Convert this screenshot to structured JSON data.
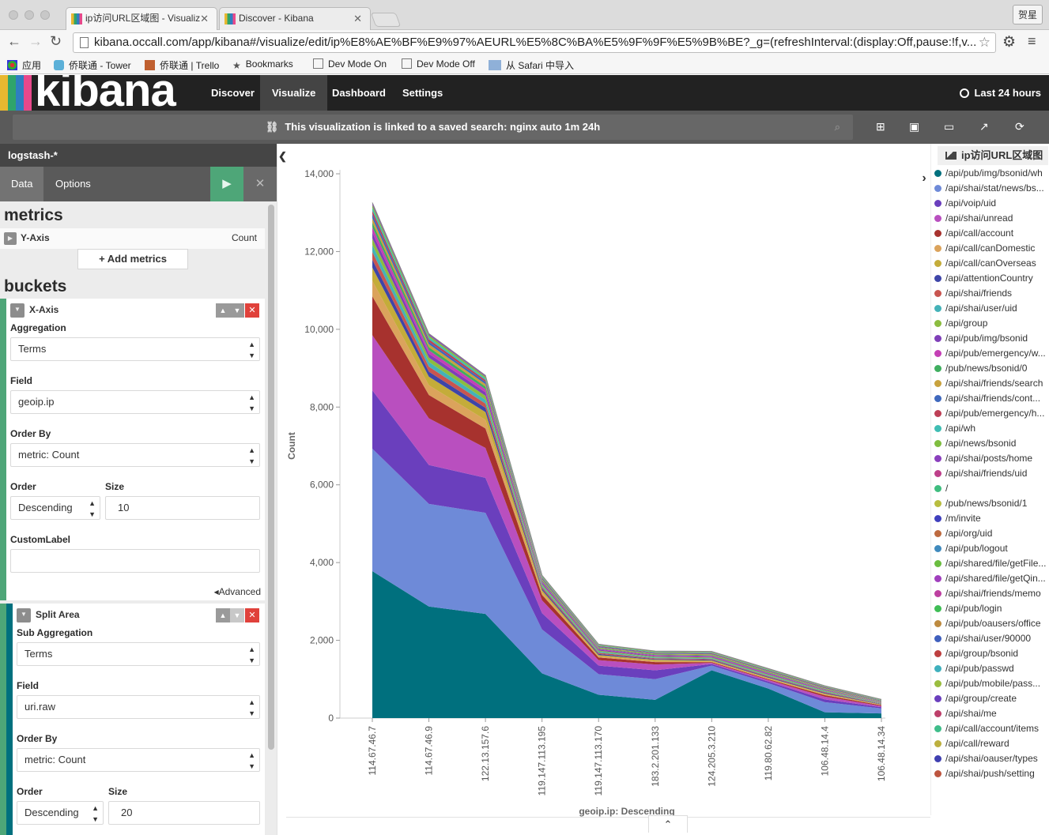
{
  "browser": {
    "tabs": [
      {
        "title": "ip访问URL区域图 - Visualiz",
        "active": true
      },
      {
        "title": "Discover - Kibana",
        "active": false
      }
    ],
    "profile": "贺星",
    "url": "kibana.occall.com/app/kibana#/visualize/edit/ip%E8%AE%BF%E9%97%AEURL%E5%8C%BA%E5%9F%9F%E5%9B%BE?_g=(refreshInterval:(display:Off,pause:!f,v...",
    "bookmarks": [
      "应用",
      "侨联通 - Tower",
      "侨联通 | Trello",
      "Bookmarks",
      "Dev Mode On",
      "Dev Mode Off",
      "从 Safari 中导入"
    ]
  },
  "kibana": {
    "logo": "kibana",
    "nav": [
      "Discover",
      "Visualize",
      "Dashboard",
      "Settings"
    ],
    "active_nav": "Visualize",
    "timepicker": "Last 24 hours",
    "linked_prefix": "This visualization is linked to a saved search: ",
    "linked_search": "nginx auto 1m 24h"
  },
  "sidebar": {
    "index": "logstash-*",
    "tabs": [
      "Data",
      "Options"
    ],
    "metrics_header": "metrics",
    "yaxis_label": "Y-Axis",
    "yaxis_value": "Count",
    "add_metrics": "Add metrics",
    "buckets_header": "buckets",
    "xaxis": {
      "title": "X-Axis",
      "aggregation_label": "Aggregation",
      "aggregation": "Terms",
      "field_label": "Field",
      "field": "geoip.ip",
      "orderby_label": "Order By",
      "orderby": "metric: Count",
      "order_label": "Order",
      "order": "Descending",
      "size_label": "Size",
      "size": "10",
      "customlabel_label": "CustomLabel",
      "customlabel": "",
      "advanced": "Advanced"
    },
    "split": {
      "title": "Split Area",
      "subagg_label": "Sub Aggregation",
      "subagg": "Terms",
      "field_label": "Field",
      "field": "uri.raw",
      "orderby_label": "Order By",
      "orderby": "metric: Count",
      "order_label": "Order",
      "order": "Descending",
      "size_label": "Size",
      "size": "20"
    }
  },
  "legend": {
    "title": "ip访问URL区域图",
    "items": [
      {
        "label": "/api/pub/img/bsonid/wh",
        "color": "#00707e"
      },
      {
        "label": "/api/shai/stat/news/bs...",
        "color": "#6e8ad8"
      },
      {
        "label": "/api/voip/uid",
        "color": "#6a3fbd"
      },
      {
        "label": "/api/shai/unread",
        "color": "#b94fbf"
      },
      {
        "label": "/api/call/account",
        "color": "#a7322e"
      },
      {
        "label": "/api/call/canDomestic",
        "color": "#dba35c"
      },
      {
        "label": "/api/call/canOverseas",
        "color": "#c4ac3a"
      },
      {
        "label": "/api/attentionCountry",
        "color": "#3e45a8"
      },
      {
        "label": "/api/shai/friends",
        "color": "#c8554f"
      },
      {
        "label": "/api/shai/user/uid",
        "color": "#44b2b8"
      },
      {
        "label": "/api/group",
        "color": "#8bbc3f"
      },
      {
        "label": "/api/pub/img/bsonid",
        "color": "#7f3fb8"
      },
      {
        "label": "/api/pub/emergency/w...",
        "color": "#c43fb5"
      },
      {
        "label": "/pub/news/bsonid/0",
        "color": "#3fae5f"
      },
      {
        "label": "/api/shai/friends/search",
        "color": "#c8a23d"
      },
      {
        "label": "/api/shai/friends/cont...",
        "color": "#3f68bd"
      },
      {
        "label": "/api/pub/emergency/h...",
        "color": "#bd3f55"
      },
      {
        "label": "/api/wh",
        "color": "#3fbdb3"
      },
      {
        "label": "/api/news/bsonid",
        "color": "#7fbd3f"
      },
      {
        "label": "/api/shai/posts/home",
        "color": "#8a3fbd"
      },
      {
        "label": "/api/shai/friends/uid",
        "color": "#bd3f8a"
      },
      {
        "label": "/",
        "color": "#3fbd7f"
      },
      {
        "label": "/pub/news/bsonid/1",
        "color": "#b8bd3f"
      },
      {
        "label": "/m/invite",
        "color": "#3f3fbd"
      },
      {
        "label": "/api/org/uid",
        "color": "#bd6a3f"
      },
      {
        "label": "/api/pub/logout",
        "color": "#3f8abd"
      },
      {
        "label": "/api/shared/file/getFile...",
        "color": "#6abd3f"
      },
      {
        "label": "/api/shared/file/getQin...",
        "color": "#a03fbd"
      },
      {
        "label": "/api/shai/friends/memo",
        "color": "#bd3fa0"
      },
      {
        "label": "/api/pub/login",
        "color": "#3fbd55"
      },
      {
        "label": "/api/pub/oausers/office",
        "color": "#bd8a3f"
      },
      {
        "label": "/api/shai/user/90000",
        "color": "#3f5fbd"
      },
      {
        "label": "/api/group/bsonid",
        "color": "#bd3f3f"
      },
      {
        "label": "/api/pub/passwd",
        "color": "#3fb0bd"
      },
      {
        "label": "/api/pub/mobile/pass...",
        "color": "#9abd3f"
      },
      {
        "label": "/api/group/create",
        "color": "#6a3fbd"
      },
      {
        "label": "/api/shai/me",
        "color": "#bd3f6a"
      },
      {
        "label": "/api/call/account/items",
        "color": "#3fbd8a"
      },
      {
        "label": "/api/call/reward",
        "color": "#bdb03f"
      },
      {
        "label": "/api/shai/oauser/types",
        "color": "#3f3fb0"
      },
      {
        "label": "/api/shai/push/setting",
        "color": "#bd553f"
      }
    ]
  },
  "chart_data": {
    "type": "area",
    "stacked": true,
    "xlabel": "geoip.ip: Descending",
    "ylabel": "Count",
    "ylim": [
      0,
      14000
    ],
    "yticks": [
      0,
      2000,
      4000,
      6000,
      8000,
      10000,
      12000,
      14000
    ],
    "ytick_labels": [
      "0",
      "2,000",
      "4,000",
      "6,000",
      "8,000",
      "10,000",
      "12,000",
      "14,000"
    ],
    "categories": [
      "114.67.46.7",
      "114.67.46.9",
      "122.13.157.6",
      "119.147.113.195",
      "119.147.113.170",
      "183.2.201.133",
      "124.205.3.210",
      "119.80.62.82",
      "106.48.14.4",
      "106.48.14.34"
    ],
    "series": [
      {
        "name": "/api/pub/img/bsonid/wh",
        "values": [
          3780,
          2870,
          2680,
          1150,
          600,
          470,
          1230,
          760,
          150,
          120
        ]
      },
      {
        "name": "/api/shai/stat/news/bs...",
        "values": [
          3150,
          2640,
          2600,
          1130,
          530,
          530,
          120,
          140,
          260,
          130
        ]
      },
      {
        "name": "/api/voip/uid",
        "values": [
          1500,
          1000,
          900,
          420,
          220,
          230,
          40,
          40,
          70,
          30
        ]
      },
      {
        "name": "/api/shai/unread",
        "values": [
          1420,
          1200,
          770,
          330,
          140,
          150,
          30,
          40,
          70,
          30
        ]
      },
      {
        "name": "/api/call/account",
        "values": [
          1000,
          600,
          500,
          140,
          70,
          60,
          20,
          20,
          40,
          20
        ]
      },
      {
        "name": "/api/call/canDomestic",
        "values": [
          400,
          250,
          220,
          60,
          30,
          30,
          20,
          20,
          20,
          10
        ]
      },
      {
        "name": "/api/call/canOverseas",
        "values": [
          340,
          220,
          200,
          60,
          30,
          30,
          20,
          20,
          20,
          10
        ]
      },
      {
        "name": "/api/attentionCountry",
        "values": [
          200,
          130,
          110,
          40,
          30,
          20,
          20,
          20,
          20,
          10
        ]
      },
      {
        "name": "/api/shai/friends",
        "values": [
          200,
          130,
          110,
          40,
          30,
          20,
          20,
          20,
          20,
          10
        ]
      },
      {
        "name": "/api/shai/user/uid",
        "values": [
          180,
          120,
          100,
          40,
          30,
          20,
          20,
          20,
          20,
          10
        ]
      },
      {
        "name": "/api/group",
        "values": [
          170,
          110,
          100,
          40,
          25,
          20,
          20,
          20,
          20,
          10
        ]
      },
      {
        "name": "/api/pub/img/bsonid",
        "values": [
          150,
          100,
          90,
          35,
          25,
          20,
          20,
          20,
          15,
          10
        ]
      },
      {
        "name": "/api/pub/emergency/w...",
        "values": [
          140,
          90,
          80,
          30,
          20,
          20,
          20,
          20,
          15,
          10
        ]
      },
      {
        "name": "/pub/news/bsonid/0",
        "values": [
          120,
          80,
          70,
          30,
          20,
          20,
          20,
          20,
          15,
          10
        ]
      },
      {
        "name": "/api/shai/friends/search",
        "values": [
          110,
          75,
          60,
          25,
          20,
          15,
          20,
          20,
          15,
          10
        ]
      },
      {
        "name": "/api/shai/friends/cont...",
        "values": [
          100,
          65,
          55,
          25,
          20,
          15,
          15,
          15,
          15,
          10
        ]
      },
      {
        "name": "/api/pub/emergency/h...",
        "values": [
          90,
          60,
          50,
          20,
          15,
          15,
          15,
          15,
          15,
          10
        ]
      },
      {
        "name": "/api/wh",
        "values": [
          80,
          55,
          45,
          20,
          15,
          15,
          15,
          15,
          10,
          10
        ]
      },
      {
        "name": "/api/news/bsonid",
        "values": [
          70,
          50,
          40,
          20,
          15,
          15,
          15,
          15,
          10,
          10
        ]
      },
      {
        "name": "/api/shai/posts/home",
        "values": [
          60,
          45,
          35,
          20,
          15,
          10,
          15,
          15,
          10,
          10
        ]
      }
    ]
  }
}
